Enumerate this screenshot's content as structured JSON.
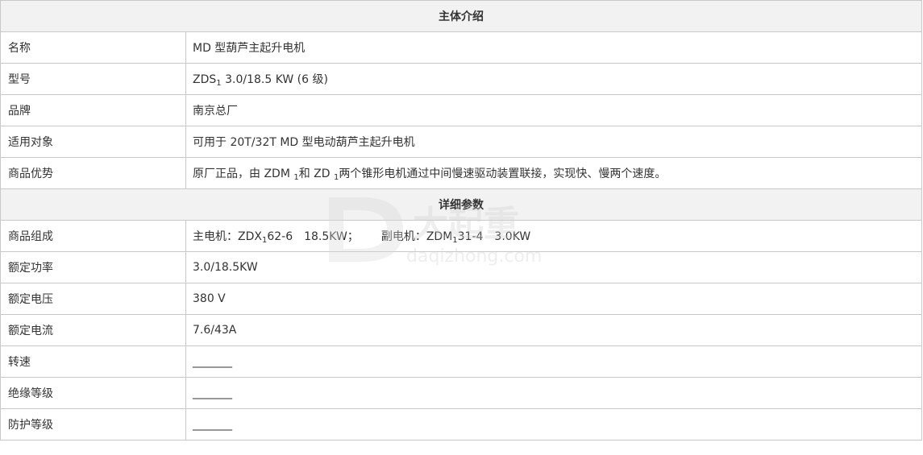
{
  "sections": {
    "intro_title": "主体介绍",
    "params_title": "详细参数"
  },
  "rows": {
    "name": {
      "label": "名称",
      "value": "MD 型葫芦主起升电机"
    },
    "model": {
      "label": "型号",
      "value_pre": "ZDS",
      "value_sub": "1",
      "value_post": " 3.0/18.5 KW (6 级)"
    },
    "brand": {
      "label": "品牌",
      "value": "南京总厂"
    },
    "applicable": {
      "label": "适用对象",
      "value": "可用于 20T/32T MD 型电动葫芦主起升电机"
    },
    "advantage": {
      "label": "商品优势",
      "value_a": "原厂正品，由 ZDM ",
      "value_sub1": "1",
      "value_b": "和 ZD ",
      "value_sub2": "1",
      "value_c": "两个锥形电机通过中间慢速驱动装置联接，实现快、慢两个速度。"
    },
    "composition": {
      "label": "商品组成",
      "main_pre": "主电机：ZDX",
      "main_sub": "1",
      "main_post": "62-6　18.5KW；",
      "aux_pre": "副电机：ZDM",
      "aux_sub": "1",
      "aux_post": "31-4　3.0KW"
    },
    "rated_power": {
      "label": "额定功率",
      "value": "3.0/18.5KW"
    },
    "rated_voltage": {
      "label": "额定电压",
      "value": "380 V"
    },
    "rated_current": {
      "label": "额定电流",
      "value": "7.6/43A"
    },
    "speed": {
      "label": "转速",
      "value": "_______"
    },
    "insulation": {
      "label": "绝缘等级",
      "value": "_______"
    },
    "protection": {
      "label": "防护等级",
      "value": "_______"
    }
  },
  "watermark": {
    "brand_text": "大起重",
    "url_text": "daqizhong.com"
  }
}
